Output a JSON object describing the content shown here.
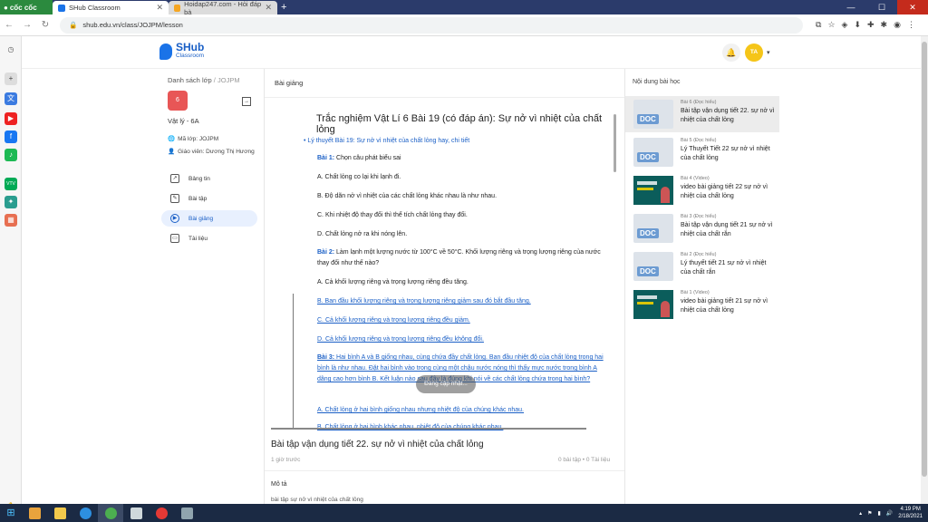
{
  "browser": {
    "brand": "cốc cốc",
    "tabs": [
      {
        "title": "SHub Classroom",
        "active": true
      },
      {
        "title": "Hoidap247.com - Hỏi đáp bà",
        "active": false
      }
    ],
    "url": "shub.edu.vn/class/JOJPM/lesson",
    "nav_icons": [
      "back-icon",
      "forward-icon",
      "reload-icon"
    ],
    "window_controls": [
      "minimize",
      "maximize",
      "close"
    ]
  },
  "header": {
    "logo_name": "SHub",
    "logo_sub": "Classroom",
    "avatar_initials": "TA"
  },
  "sidebar": {
    "breadcrumb_root": "Danh sách lớp",
    "breadcrumb_sep": "/",
    "breadcrumb_code": "JOJPM",
    "class_badge": "6",
    "class_name": "Vật lý - 6A",
    "class_code": "Mã lớp: JOJPM",
    "teacher": "Giáo viên: Dương Thị Hương",
    "menu": [
      {
        "label": "Bảng tin",
        "icon": "chart-icon",
        "active": false
      },
      {
        "label": "Bài tập",
        "icon": "edit-icon",
        "active": false
      },
      {
        "label": "Bài giảng",
        "icon": "play-icon",
        "active": true
      },
      {
        "label": "Tài liệu",
        "icon": "folder-icon",
        "active": false
      }
    ]
  },
  "main": {
    "section_title": "Bài giảng",
    "doc": {
      "title": "Trắc nghiệm Vật Lí 6 Bài 19 (có đáp án): Sự nở vì nhiệt của chất lỏng",
      "bullet": "Lý thuyết Bài 19: Sự nở vì nhiệt của chất lỏng hay, chi tiết",
      "q1_label": "Bài 1:",
      "q1_text": " Chọn câu phát biểu sai",
      "q1_a": "A. Chất lỏng co lại khi lạnh đi.",
      "q1_b": "B. Độ dãn nở vì nhiệt của các chất lỏng khác nhau là như nhau.",
      "q1_c": "C. Khi nhiệt độ thay đổi thì thể tích chất lỏng thay đổi.",
      "q1_d": "D. Chất lỏng nở ra khi nóng lên.",
      "q2_label": "Bài 2:",
      "q2_text": " Làm lạnh một lượng nước từ 100°C về 50°C. Khối lượng riêng và trọng lượng riêng của nước thay đổi như thế nào?",
      "q2_a": "A. Cả khối lượng riêng và trọng lượng riêng đều tăng.",
      "q2_b": "B. Ban đầu khối lượng riêng và trọng lượng riêng giảm sau đó bắt đầu tăng.",
      "q2_c": "C. Cả khối lượng riêng và trọng lượng riêng đều giảm.",
      "q2_d": "D. Cả khối lượng riêng và trọng lượng riêng đều không đổi.",
      "q3_label": "Bài 3:",
      "q3_text": " Hai bình A và B giống nhau, cùng chứa đầy chất lỏng. Ban đầu nhiệt độ của chất lỏng trong hai bình là như nhau. Đặt hai bình vào trong cùng một chậu nước nóng thì thấy mực nước trong bình A dâng cao hơn bình B. Kết luận nào sau đây là đúng khi nói về các chất lỏng chứa trong hai bình?",
      "q3_a": "A. Chất lỏng ở hai bình giống nhau nhưng nhiệt độ của chúng khác nhau.",
      "q3_b": "B. Chất lỏng ở hai bình khác nhau, nhiệt độ của chúng khác nhau.",
      "loading_text": "Đang cập nhật..."
    },
    "lesson_title": "Bài tập vận dụng tiết 22. sự nở vì nhiệt của chất lỏng",
    "lesson_time": "1 giờ trước",
    "lesson_count": "0 bài tập • 0 Tài liệu",
    "desc_label": "Mô tả",
    "desc_text": "bài tập sự nở vì nhiệt của chất lỏng"
  },
  "right": {
    "title": "Nội dung bài học",
    "items": [
      {
        "type": "Bài 6 (Đọc hiểu)",
        "name": "Bài tập vận dụng tiết 22. sự nở vì nhiệt của chất lỏng",
        "kind": "doc",
        "active": true
      },
      {
        "type": "Bài 5 (Đọc hiểu)",
        "name": "Lý Thuyết Tiết 22 sự nở vì nhiệt của chất lỏng",
        "kind": "doc",
        "active": false
      },
      {
        "type": "Bài 4 (Video)",
        "name": "video bài giảng tiết 22 sự nở vì nhiệt của chất lỏng",
        "kind": "video",
        "active": false
      },
      {
        "type": "Bài 3 (Đọc hiểu)",
        "name": "Bài tập vận dụng tiết 21 sự nở vì nhiệt của chất rắn",
        "kind": "doc",
        "active": false
      },
      {
        "type": "Bài 2 (Đọc hiểu)",
        "name": "Lý thuyết tiết 21 sự nở vì nhiệt của chất rắn",
        "kind": "doc",
        "active": false
      },
      {
        "type": "Bài 1 (Video)",
        "name": "video bài giảng tiết 21 sự nở vì nhiệt của chất lỏng",
        "kind": "video",
        "active": false
      }
    ],
    "doc_badge": "DOC"
  },
  "taskbar": {
    "time": "4:19 PM",
    "date": "2/18/2021"
  },
  "colors": {
    "accent": "#1a5fc6",
    "badge": "#e85656",
    "avatar": "#f5c518",
    "tabbar": "#2b3b6b"
  }
}
